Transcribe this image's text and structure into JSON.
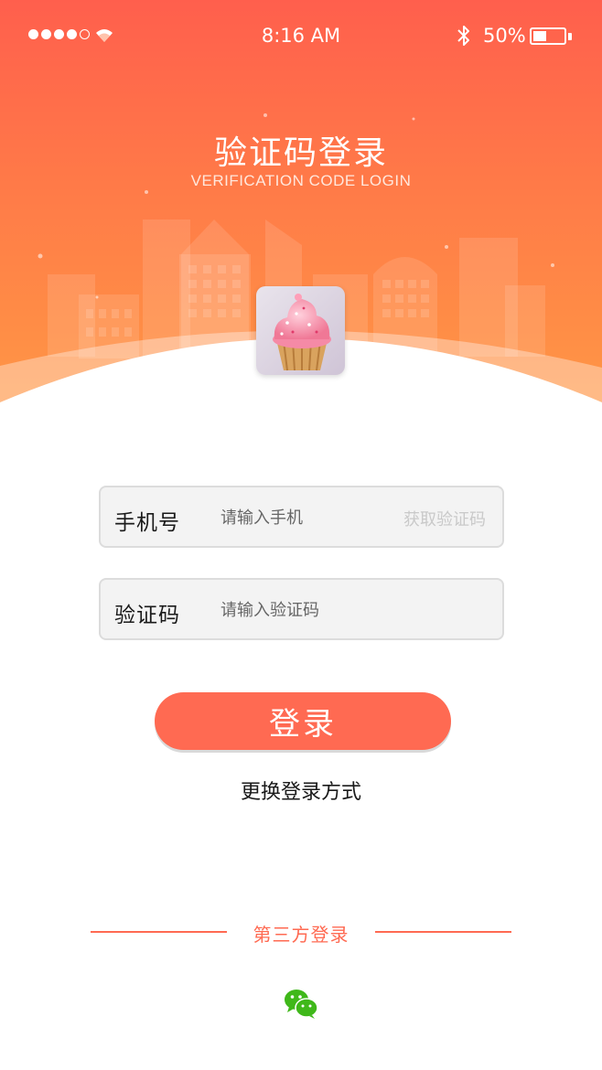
{
  "status_bar": {
    "time": "8:16   AM",
    "battery_percent": "50%",
    "battery_level": 0.5,
    "signal_bars": 4,
    "signal_total": 5
  },
  "header": {
    "title": "验证码登录",
    "subtitle": "VERIFICATION CODE LOGIN"
  },
  "form": {
    "phone_label": "手机号",
    "phone_placeholder": "请输入手机",
    "get_code_label": "获取验证码",
    "code_label": "验证码",
    "code_placeholder": "请输入验证码"
  },
  "actions": {
    "login_label": "登录",
    "switch_label": "更换登录方式"
  },
  "third_party": {
    "label": "第三方登录",
    "providers": [
      "wechat-icon"
    ]
  },
  "colors": {
    "header_top": "#ff5f4d",
    "header_bottom": "#ff9845",
    "accent": "#ff6a52",
    "wechat": "#3fb81a"
  }
}
